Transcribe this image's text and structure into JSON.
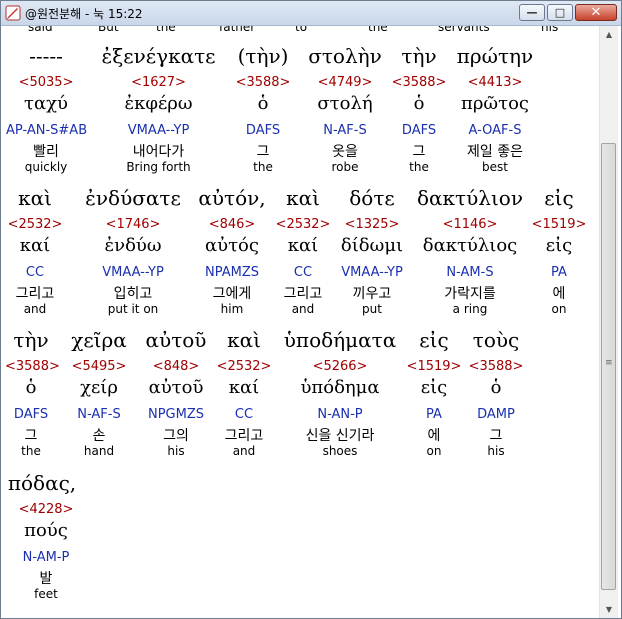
{
  "window": {
    "title": "@원전분해 - 눅 15:22",
    "buttons": {
      "minimize": "—",
      "maximize": "□",
      "close": "✕"
    }
  },
  "scrollbar": {
    "up": "▲",
    "down": "▼",
    "grip": "≡"
  },
  "prev_line": [
    "said",
    "But",
    "the",
    "father",
    "to",
    "the",
    "servants",
    "his"
  ],
  "rows": [
    {
      "words": [
        {
          "greek": "-----",
          "strong": "<5035>",
          "lemma": "ταχύ",
          "parse": "AP-AN-S#AB",
          "kor": "빨리",
          "eng": "quickly"
        },
        {
          "greek": "ἐξενέγκατε",
          "strong": "<1627>",
          "lemma": "ἐκφέρω",
          "parse": "VMAA--YP",
          "kor": "내어다가",
          "eng": "Bring forth"
        },
        {
          "greek": "(τὴν)",
          "strong": "<3588>",
          "lemma": "ὁ",
          "parse": "DAFS",
          "kor": "그",
          "eng": "the"
        },
        {
          "greek": "στολὴν",
          "strong": "<4749>",
          "lemma": "στολή",
          "parse": "N-AF-S",
          "kor": "옷을",
          "eng": "robe"
        },
        {
          "greek": "τὴν",
          "strong": "<3588>",
          "lemma": "ὁ",
          "parse": "DAFS",
          "kor": "그",
          "eng": "the"
        },
        {
          "greek": "πρώτην",
          "strong": "<4413>",
          "lemma": "πρῶτος",
          "parse": "A-OAF-S",
          "kor": "제일 좋은",
          "eng": "best"
        }
      ]
    },
    {
      "words": [
        {
          "greek": "καὶ",
          "strong": "<2532>",
          "lemma": "καί",
          "parse": "CC",
          "kor": "그리고",
          "eng": "and"
        },
        {
          "greek": "ἐνδύσατε",
          "strong": "<1746>",
          "lemma": "ἐνδύω",
          "parse": "VMAA--YP",
          "kor": "입히고",
          "eng": "put it on"
        },
        {
          "greek": "αὐτόν,",
          "strong": "<846>",
          "lemma": "αὐτός",
          "parse": "NPAMZS",
          "kor": "그에게",
          "eng": "him"
        },
        {
          "greek": "καὶ",
          "strong": "<2532>",
          "lemma": "καί",
          "parse": "CC",
          "kor": "그리고",
          "eng": "and"
        },
        {
          "greek": "δότε",
          "strong": "<1325>",
          "lemma": "δίδωμι",
          "parse": "VMAA--YP",
          "kor": "끼우고",
          "eng": "put"
        },
        {
          "greek": "δακτύλιον",
          "strong": "<1146>",
          "lemma": "δακτύλιος",
          "parse": "N-AM-S",
          "kor": "가락지를",
          "eng": "a ring"
        },
        {
          "greek": "εἰς",
          "strong": "<1519>",
          "lemma": "εἰς",
          "parse": "PA",
          "kor": "에",
          "eng": "on"
        }
      ]
    },
    {
      "words": [
        {
          "greek": "τὴν",
          "strong": "<3588>",
          "lemma": "ὁ",
          "parse": "DAFS",
          "kor": "그",
          "eng": "the"
        },
        {
          "greek": "χεῖρα",
          "strong": "<5495>",
          "lemma": "χείρ",
          "parse": "N-AF-S",
          "kor": "손",
          "eng": "hand"
        },
        {
          "greek": "αὐτοῦ",
          "strong": "<848>",
          "lemma": "αὐτοῦ",
          "parse": "NPGMZS",
          "kor": "그의",
          "eng": "his"
        },
        {
          "greek": "καὶ",
          "strong": "<2532>",
          "lemma": "καί",
          "parse": "CC",
          "kor": "그리고",
          "eng": "and"
        },
        {
          "greek": "ὑποδήματα",
          "strong": "<5266>",
          "lemma": "ὑπόδημα",
          "parse": "N-AN-P",
          "kor": "신을 신기라",
          "eng": "shoes"
        },
        {
          "greek": "εἰς",
          "strong": "<1519>",
          "lemma": "εἰς",
          "parse": "PA",
          "kor": "에",
          "eng": "on"
        },
        {
          "greek": "τοὺς",
          "strong": "<3588>",
          "lemma": "ὁ",
          "parse": "DAMP",
          "kor": "그",
          "eng": "his"
        }
      ]
    },
    {
      "words": [
        {
          "greek": "πόδας,",
          "strong": "<4228>",
          "lemma": "πούς",
          "parse": "N-AM-P",
          "kor": "발",
          "eng": "feet"
        }
      ]
    }
  ]
}
